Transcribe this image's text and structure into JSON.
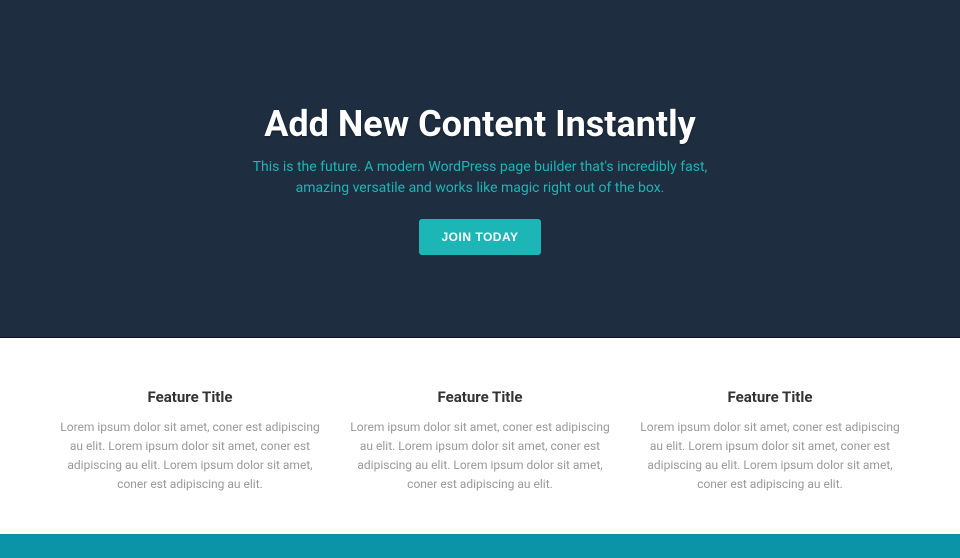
{
  "colors": {
    "hero_bg": "#1e2d3f",
    "accent": "#1cb6b6",
    "bottom_bar": "#0b93a8"
  },
  "hero": {
    "title": "Add New Content Instantly",
    "subtitle": "This is the future. A modern WordPress page builder that's incredibly fast, amazing versatile and works like magic right out of the box.",
    "cta_label": "JOIN TODAY"
  },
  "features": [
    {
      "title": "Feature Title",
      "desc": "Lorem ipsum dolor sit amet, coner est adipiscing au elit. Lorem ipsum dolor sit amet, coner est adipiscing au elit. Lorem ipsum dolor sit amet, coner est adipiscing au elit."
    },
    {
      "title": "Feature Title",
      "desc": "Lorem ipsum dolor sit amet, coner est adipiscing au elit. Lorem ipsum dolor sit amet, coner est adipiscing au elit. Lorem ipsum dolor sit amet, coner est adipiscing au elit."
    },
    {
      "title": "Feature Title",
      "desc": "Lorem ipsum dolor sit amet, coner est adipiscing au elit. Lorem ipsum dolor sit amet, coner est adipiscing au elit. Lorem ipsum dolor sit amet, coner est adipiscing au elit."
    }
  ]
}
